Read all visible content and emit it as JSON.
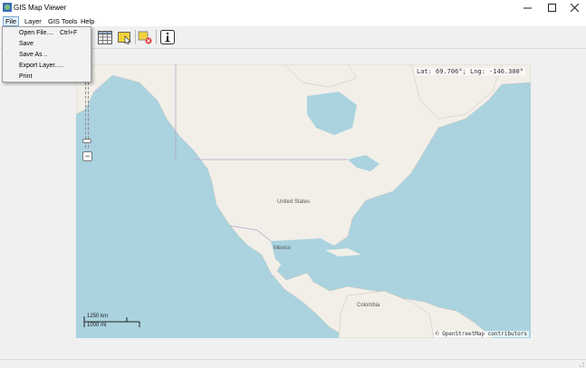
{
  "window": {
    "title": "GIS Map Viewer"
  },
  "menubar": {
    "items": [
      {
        "label": "File"
      },
      {
        "label": "Layer"
      },
      {
        "label": "GIS Tools"
      },
      {
        "label": "Help"
      }
    ]
  },
  "file_menu": {
    "items": [
      {
        "label": "Open File....",
        "shortcut": "Ctrl+F"
      },
      {
        "label": "Save",
        "shortcut": ""
      },
      {
        "label": "Save As ..",
        "shortcut": ""
      },
      {
        "label": "Export Layer.....",
        "shortcut": ""
      },
      {
        "label": "Print",
        "shortcut": ""
      }
    ]
  },
  "toolbar": {
    "icons": [
      "table-icon",
      "select-feature-icon",
      "clear-selection-icon",
      "info-icon"
    ]
  },
  "map": {
    "coordinates": "Lat: 69.706°; Lng: -146.300°",
    "attribution": "© OpenStreetMap contributors",
    "scale_km": "1250 km",
    "scale_mi": "1000 mi",
    "labels": {
      "us": "United States",
      "mexico": "México",
      "colombia": "Colombia"
    },
    "colors": {
      "water": "#aad3df",
      "land": "#f2efe9",
      "border": "#c5b3c8"
    }
  }
}
